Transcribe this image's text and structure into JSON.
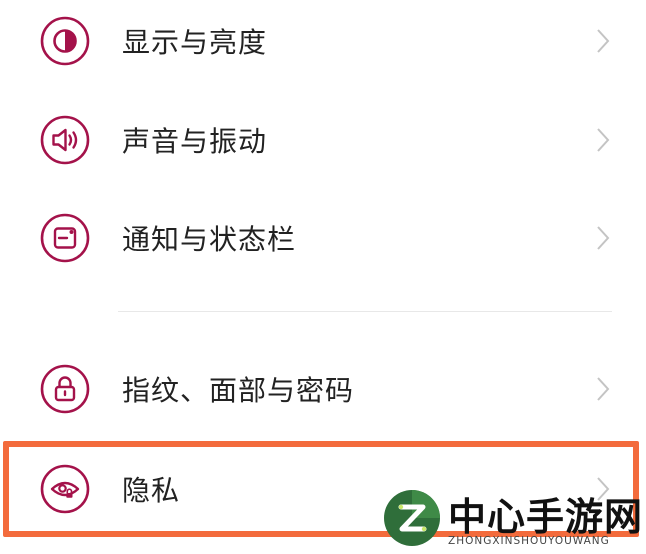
{
  "settings": {
    "items": [
      {
        "label": "显示与亮度",
        "icon": "display-brightness-icon"
      },
      {
        "label": "声音与振动",
        "icon": "speaker-icon"
      },
      {
        "label": "通知与状态栏",
        "icon": "notification-bar-icon"
      },
      {
        "label": "指纹、面部与密码",
        "icon": "lock-icon"
      },
      {
        "label": "隐私",
        "icon": "eye-lock-icon",
        "highlighted": true
      }
    ]
  },
  "colors": {
    "icon_accent": "#a4124a",
    "highlight_border": "#f36b3c",
    "chevron": "#c4c4c4",
    "watermark_logo": "#2f6e3a"
  },
  "watermark": {
    "title": "中心手游网",
    "subtitle": "ZHONGXINSHOUYOUWANG"
  }
}
